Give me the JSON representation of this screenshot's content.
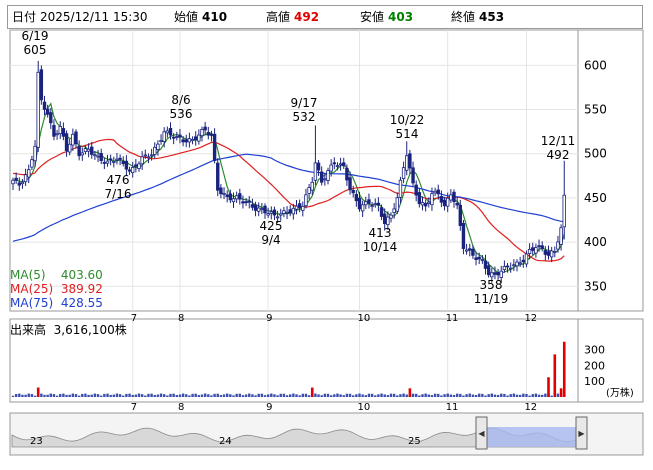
{
  "header": {
    "date_label": "日付",
    "datetime": "2025/12/11 15:30",
    "open_label": "始値",
    "open": "410",
    "high_label": "高値",
    "high": "492",
    "low_label": "安値",
    "low": "403",
    "close_label": "終値",
    "close": "453"
  },
  "colors": {
    "up": "#ffffff",
    "down": "#1a237e",
    "ma5": "#2e8b2e",
    "ma25": "#e02020",
    "ma75": "#2040d0",
    "volume": "#3a4fb0",
    "volume_spike": "#e00000",
    "high_text": "#e00000",
    "low_text": "#008000"
  },
  "ma_legend": [
    {
      "label": "MA(5)",
      "value": "403.60"
    },
    {
      "label": "MA(25)",
      "value": "389.92"
    },
    {
      "label": "MA(75)",
      "value": "428.55"
    }
  ],
  "volume_panel": {
    "label": "出来高",
    "value": "3,616,100株",
    "unit": "(万株)",
    "ticks": [
      "300",
      "200",
      "100"
    ]
  },
  "navigator": {
    "year_labels": [
      "23",
      "24",
      "25"
    ]
  },
  "chart_data": {
    "type": "candlestick",
    "y_ticks": [
      600,
      550,
      500,
      450,
      400,
      350
    ],
    "ylim": [
      322,
      640
    ],
    "x_month_labels": [
      "7",
      "8",
      "9",
      "10",
      "11",
      "12"
    ],
    "annotations": [
      {
        "date": "6/19",
        "value": 605,
        "kind": "high"
      },
      {
        "date": "7/16",
        "value": 476,
        "kind": "low"
      },
      {
        "date": "8/6",
        "value": 536,
        "kind": "high"
      },
      {
        "date": "9/4",
        "value": 425,
        "kind": "low"
      },
      {
        "date": "9/17",
        "value": 532,
        "kind": "high"
      },
      {
        "date": "10/14",
        "value": 413,
        "kind": "low"
      },
      {
        "date": "10/22",
        "value": 514,
        "kind": "high"
      },
      {
        "date": "11/19",
        "value": 358,
        "kind": "low"
      },
      {
        "date": "12/11",
        "value": 492,
        "kind": "high"
      }
    ],
    "price_anchors": [
      [
        0,
        470
      ],
      [
        2,
        465
      ],
      [
        5,
        480
      ],
      [
        7,
        510
      ],
      [
        8,
        590
      ],
      [
        9,
        560
      ],
      [
        11,
        545
      ],
      [
        13,
        520
      ],
      [
        15,
        530
      ],
      [
        17,
        505
      ],
      [
        19,
        520
      ],
      [
        21,
        500
      ],
      [
        24,
        505
      ],
      [
        27,
        495
      ],
      [
        30,
        490
      ],
      [
        33,
        495
      ],
      [
        36,
        485
      ],
      [
        37,
        480
      ],
      [
        38,
        482
      ],
      [
        41,
        495
      ],
      [
        44,
        500
      ],
      [
        46,
        510
      ],
      [
        48,
        525
      ],
      [
        51,
        520
      ],
      [
        54,
        515
      ],
      [
        57,
        515
      ],
      [
        60,
        525
      ],
      [
        61,
        527
      ],
      [
        63,
        520
      ],
      [
        65,
        460
      ],
      [
        68,
        450
      ],
      [
        71,
        450
      ],
      [
        74,
        445
      ],
      [
        77,
        438
      ],
      [
        80,
        435
      ],
      [
        82,
        432
      ],
      [
        83,
        430
      ],
      [
        86,
        433
      ],
      [
        89,
        437
      ],
      [
        92,
        442
      ],
      [
        95,
        470
      ],
      [
        96,
        490
      ],
      [
        98,
        468
      ],
      [
        100,
        480
      ],
      [
        102,
        490
      ],
      [
        105,
        485
      ],
      [
        107,
        460
      ],
      [
        110,
        440
      ],
      [
        113,
        445
      ],
      [
        116,
        440
      ],
      [
        118,
        422
      ],
      [
        120,
        430
      ],
      [
        122,
        450
      ],
      [
        124,
        485
      ],
      [
        125,
        500
      ],
      [
        127,
        465
      ],
      [
        129,
        445
      ],
      [
        131,
        440
      ],
      [
        133,
        455
      ],
      [
        135,
        455
      ],
      [
        137,
        440
      ],
      [
        139,
        455
      ],
      [
        141,
        440
      ],
      [
        143,
        395
      ],
      [
        146,
        385
      ],
      [
        149,
        378
      ],
      [
        151,
        365
      ],
      [
        153,
        362
      ],
      [
        155,
        368
      ],
      [
        157,
        372
      ],
      [
        160,
        375
      ],
      [
        162,
        380
      ],
      [
        164,
        390
      ],
      [
        166,
        395
      ],
      [
        168,
        392
      ],
      [
        170,
        385
      ],
      [
        172,
        390
      ],
      [
        174,
        415
      ],
      [
        175,
        453
      ]
    ],
    "ma_start": {
      "ma25": 478,
      "ma75": 400
    },
    "volume_spikes": [
      {
        "month": "6",
        "value": 60
      },
      {
        "month": "9",
        "value": 60
      },
      {
        "month": "10",
        "value": 55
      },
      {
        "month": "12",
        "value": 125
      },
      {
        "month": "12",
        "value": 270
      },
      {
        "month": "12",
        "value": 55
      },
      {
        "month": "12",
        "value": 350
      }
    ],
    "vol_ticks": [
      300,
      200,
      100
    ],
    "vol_max": 380
  }
}
